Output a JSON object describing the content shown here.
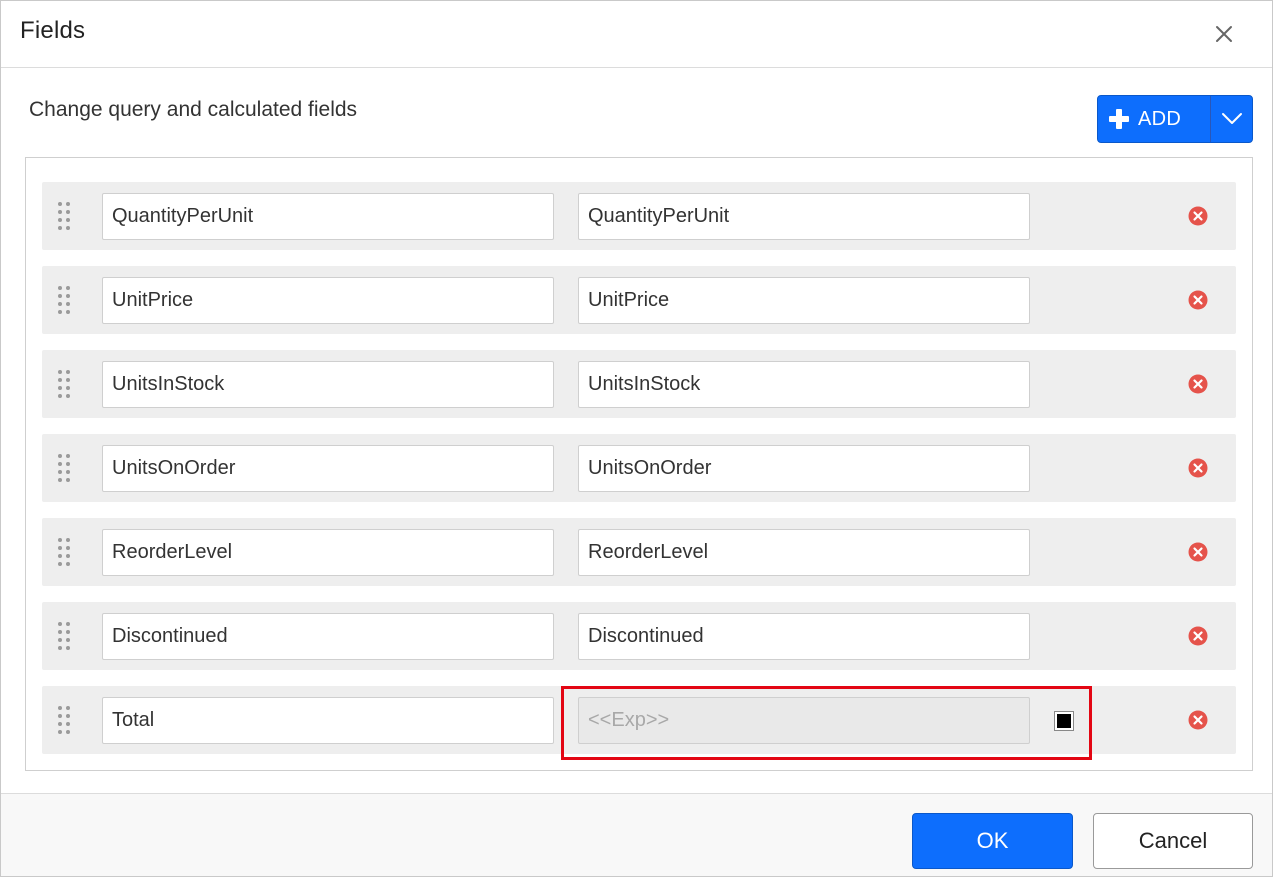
{
  "dialog": {
    "title": "Fields",
    "subtitle": "Change query and calculated fields",
    "close_icon": "close-icon"
  },
  "add_button": {
    "label": "ADD",
    "icon": "plus-icon",
    "dropdown_icon": "chevron-down-icon"
  },
  "fields": [
    {
      "name": "QuantityPerUnit",
      "value": "QuantityPerUnit"
    },
    {
      "name": "UnitPrice",
      "value": "UnitPrice"
    },
    {
      "name": "UnitsInStock",
      "value": "UnitsInStock"
    },
    {
      "name": "UnitsOnOrder",
      "value": "UnitsOnOrder"
    },
    {
      "name": "ReorderLevel",
      "value": "ReorderLevel"
    },
    {
      "name": "Discontinued",
      "value": "Discontinued"
    }
  ],
  "calculated_field": {
    "name": "Total",
    "expression_value": "",
    "expression_placeholder": "<<Exp>>"
  },
  "footer": {
    "ok_label": "OK",
    "cancel_label": "Cancel"
  },
  "colors": {
    "primary": "#0d6efd",
    "remove": "#e5534b",
    "highlight": "#e30613"
  }
}
